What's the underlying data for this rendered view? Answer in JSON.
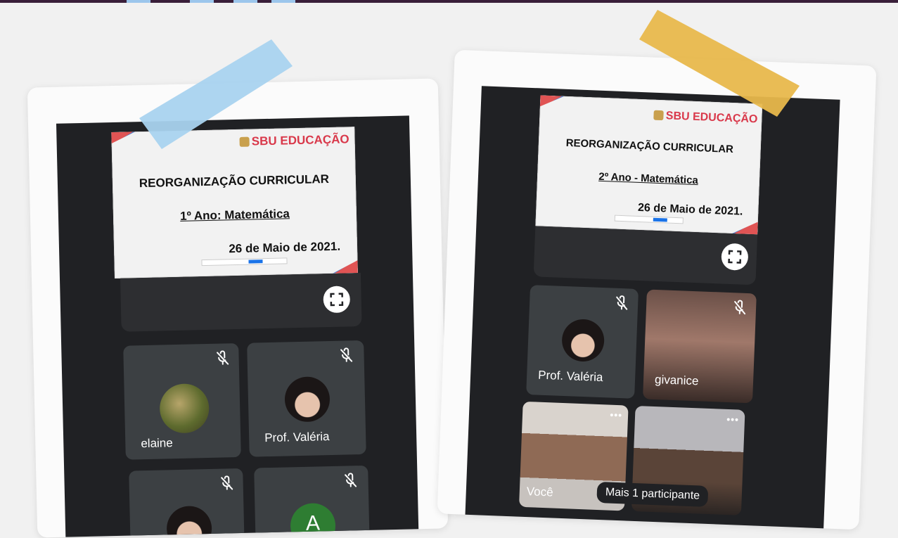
{
  "colors": {
    "tape_left": "#a9d3ef",
    "tape_right": "#e8b84c",
    "brand": "#d9384a",
    "meet_bg": "#202124",
    "tile": "#3c4043"
  },
  "left_photo": {
    "slide": {
      "brand": "SBU EDUCAÇÃO",
      "title": "REORGANIZAÇÃO CURRICULAR",
      "subtitle": "1º Ano:  Matemática",
      "date": "26 de Maio de 2021."
    },
    "tiles": [
      {
        "name": "elaine"
      },
      {
        "name": "Prof. Valéria"
      }
    ],
    "avatar_letter": "A"
  },
  "right_photo": {
    "slide": {
      "brand": "SBU EDUCAÇÃO",
      "title": "REORGANIZAÇÃO CURRICULAR",
      "subtitle": "2º Ano -  Matemática",
      "date": "26 de Maio de 2021."
    },
    "tiles": [
      {
        "name": "Prof. Valéria"
      },
      {
        "name": "givanice"
      },
      {
        "name": "Você"
      }
    ],
    "more_label": "•••",
    "more_participants": "Mais 1 participante"
  },
  "icons": {
    "mic": "mic-off-icon",
    "expand": "fullscreen-icon"
  }
}
